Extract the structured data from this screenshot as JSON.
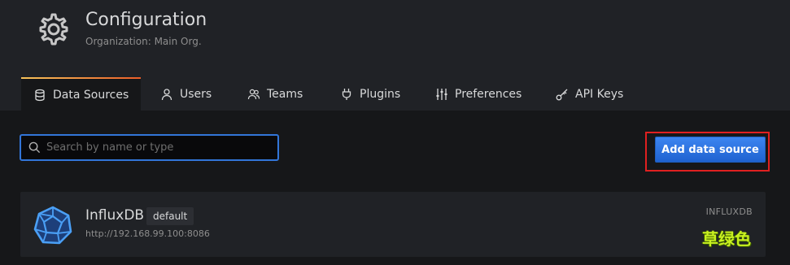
{
  "page": {
    "title": "Configuration",
    "subtitle": "Organization: Main Org."
  },
  "tabs": [
    {
      "label": "Data Sources",
      "icon": "database-icon",
      "active": true
    },
    {
      "label": "Users",
      "icon": "user-icon",
      "active": false
    },
    {
      "label": "Teams",
      "icon": "users-icon",
      "active": false
    },
    {
      "label": "Plugins",
      "icon": "plug-icon",
      "active": false
    },
    {
      "label": "Preferences",
      "icon": "sliders-icon",
      "active": false
    },
    {
      "label": "API Keys",
      "icon": "key-icon",
      "active": false
    }
  ],
  "search": {
    "placeholder": "Search by name or type",
    "value": ""
  },
  "actions": {
    "add_label": "Add data source"
  },
  "datasources": [
    {
      "name": "InfluxDB",
      "badge": "default",
      "url": "http://192.168.99.100:8086",
      "type": "INFLUXDB",
      "icon": "influxdb-logo"
    }
  ],
  "watermark": "草绿色",
  "colors": {
    "background": "#161719",
    "header": "#202226",
    "accent_blue": "#3275d8",
    "tab_accent": "#f0883e",
    "highlight_red": "#e02020",
    "watermark": "#c8f020"
  }
}
